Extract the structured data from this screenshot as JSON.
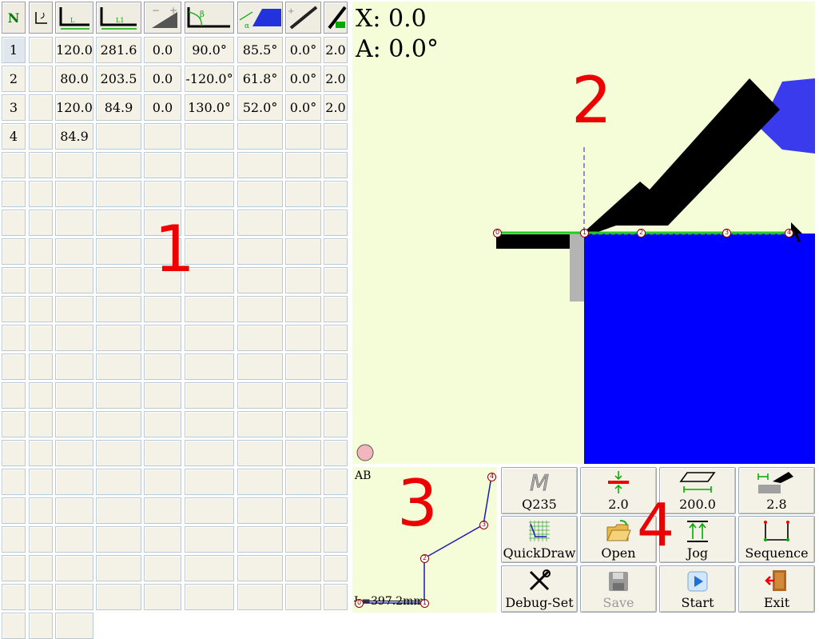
{
  "table": {
    "n_header": "N",
    "columns": [
      {
        "key": "n",
        "icon": "n-header"
      },
      {
        "key": "c",
        "icon": "reverse-c-icon"
      },
      {
        "key": "L",
        "icon": "length-l-icon"
      },
      {
        "key": "L1",
        "icon": "length-l1-icon"
      },
      {
        "key": "p3",
        "icon": "angle-disabled-icon"
      },
      {
        "key": "beta",
        "icon": "beta-angle-icon"
      },
      {
        "key": "alpha",
        "icon": "alpha-punch-icon"
      },
      {
        "key": "a0",
        "icon": "slant-angle-icon"
      },
      {
        "key": "t",
        "icon": "thickness-icon"
      }
    ],
    "rows": [
      [
        "1",
        "",
        "120.0",
        "281.6",
        "0.0",
        "90.0°",
        "85.5°",
        "0.0°",
        "2.0"
      ],
      [
        "2",
        "",
        "80.0",
        "203.5",
        "0.0",
        "-120.0°",
        "61.8°",
        "0.0°",
        "2.0"
      ],
      [
        "3",
        "",
        "120.0",
        "84.9",
        "0.0",
        "130.0°",
        "52.0°",
        "0.0°",
        "2.0"
      ],
      [
        "4",
        "",
        "84.9",
        "",
        "",
        "",
        "",
        "",
        ""
      ]
    ],
    "empty_rows": 16,
    "partial_last_row_cols": 3
  },
  "main_view": {
    "x_readout": "X: 0.0",
    "a_readout": "A: 0.0°",
    "region_label": "2",
    "point_labels": [
      "0",
      "1",
      "2",
      "3",
      "4"
    ]
  },
  "region_labels": {
    "table": "1",
    "preview": "3",
    "buttons": "4"
  },
  "preview": {
    "title": "AB",
    "length": "L=397.2mm",
    "point_labels": [
      "0",
      "1",
      "2",
      "3",
      "4"
    ]
  },
  "buttons": [
    {
      "name": "material-button",
      "label": "Q235",
      "icon": "material-m-icon",
      "disabled": false
    },
    {
      "name": "thickness-button",
      "label": "2.0",
      "icon": "thickness-arrow-icon",
      "disabled": false
    },
    {
      "name": "width-button",
      "label": "200.0",
      "icon": "sheet-width-icon",
      "disabled": false
    },
    {
      "name": "die-button",
      "label": "2.8",
      "icon": "punch-die-icon",
      "disabled": false
    },
    {
      "name": "quickdraw-button",
      "label": "QuickDraw",
      "icon": "quickdraw-grid-icon",
      "disabled": false
    },
    {
      "name": "open-button",
      "label": "Open",
      "icon": "open-folder-icon",
      "disabled": false
    },
    {
      "name": "jog-button",
      "label": "Jog",
      "icon": "jog-arrows-icon",
      "disabled": false
    },
    {
      "name": "sequence-button",
      "label": "Sequence",
      "icon": "sequence-shape-icon",
      "disabled": false
    },
    {
      "name": "debug-set-button",
      "label": "Debug-Set",
      "icon": "tools-icon",
      "disabled": false
    },
    {
      "name": "save-button",
      "label": "Save",
      "icon": "save-disk-icon",
      "disabled": true
    },
    {
      "name": "start-button",
      "label": "Start",
      "icon": "play-icon",
      "disabled": false
    },
    {
      "name": "exit-button",
      "label": "Exit",
      "icon": "exit-door-icon",
      "disabled": false
    }
  ],
  "colors": {
    "view_bg": "#f4fcd8",
    "blue": "#0000ff",
    "red_label": "#ee0000",
    "green_line": "#22cc22",
    "cell_bg": "#f4f1e6"
  }
}
